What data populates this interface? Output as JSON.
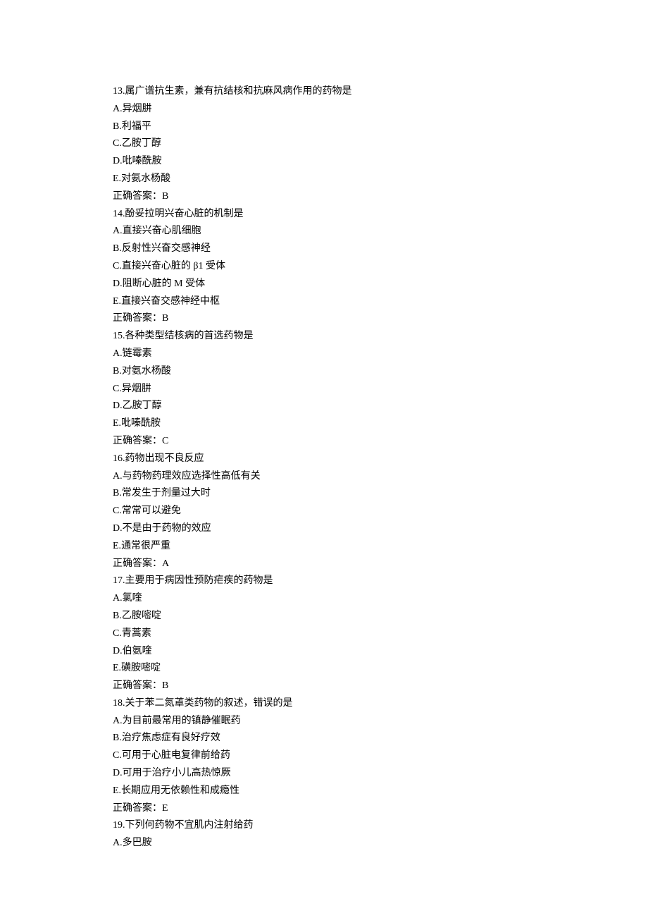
{
  "questions": [
    {
      "num": "13",
      "stem": "属广谱抗生素，兼有抗结核和抗麻风病作用的药物是",
      "options": {
        "A": "异烟肼",
        "B": "利福平",
        "C": "乙胺丁醇",
        "D": "吡嗪酰胺",
        "E": "对氨水杨酸"
      },
      "answer_label": "正确答案：",
      "answer": "B"
    },
    {
      "num": "14",
      "stem": "酚妥拉明兴奋心脏的机制是",
      "options": {
        "A": "直接兴奋心肌细胞",
        "B": "反射性兴奋交感神经",
        "C": "直接兴奋心脏的 β1 受体",
        "D": "阻断心脏的 M 受体",
        "E": "直接兴奋交感神经中枢"
      },
      "answer_label": "正确答案：",
      "answer": "B"
    },
    {
      "num": "15",
      "stem": "各种类型结核病的首选药物是",
      "options": {
        "A": "链霉素",
        "B": "对氨水杨酸",
        "C": "异烟肼",
        "D": "乙胺丁醇",
        "E": "吡嗪酰胺"
      },
      "answer_label": "正确答案：",
      "answer": "C"
    },
    {
      "num": "16",
      "stem": "药物出现不良反应",
      "options": {
        "A": "与药物药理效应选择性高低有关",
        "B": "常发生于剂量过大时",
        "C": "常常可以避免",
        "D": "不是由于药物的效应",
        "E": "通常很严重"
      },
      "answer_label": "正确答案：",
      "answer": "A"
    },
    {
      "num": "17",
      "stem": "主要用于病因性预防疟疾的药物是",
      "options": {
        "A": "氯喹",
        "B": "乙胺嘧啶",
        "C": "青蒿素",
        "D": "伯氨喹",
        "E": "磺胺嘧啶"
      },
      "answer_label": "正确答案：",
      "answer": "B"
    },
    {
      "num": "18",
      "stem": "关于苯二氮䓬类药物的叙述，错误的是",
      "options": {
        "A": "为目前最常用的镇静催眠药",
        "B": "治疗焦虑症有良好疗效",
        "C": "可用于心脏电复律前给药",
        "D": "可用于治疗小儿高热惊厥",
        "E": "长期应用无依赖性和成瘾性"
      },
      "answer_label": "正确答案：",
      "answer": "E"
    },
    {
      "num": "19",
      "stem": "下列何药物不宜肌内注射给药",
      "options": {
        "A": "多巴胺"
      },
      "answer_label": "",
      "answer": ""
    }
  ]
}
